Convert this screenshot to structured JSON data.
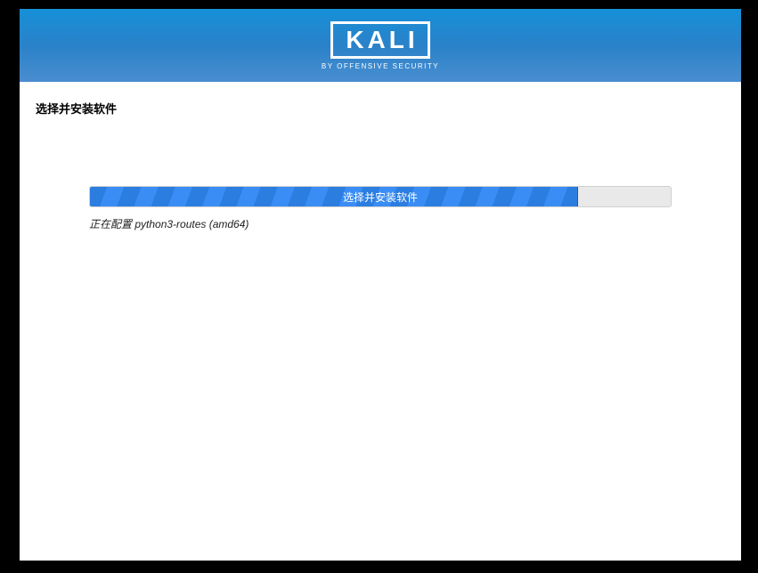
{
  "header": {
    "logo_text": "KALI",
    "subtitle": "BY OFFENSIVE SECURITY"
  },
  "page": {
    "title": "选择并安装软件"
  },
  "progress": {
    "label": "选择并安装软件",
    "percent": 84,
    "status": "正在配置 python3-routes (amd64)"
  }
}
